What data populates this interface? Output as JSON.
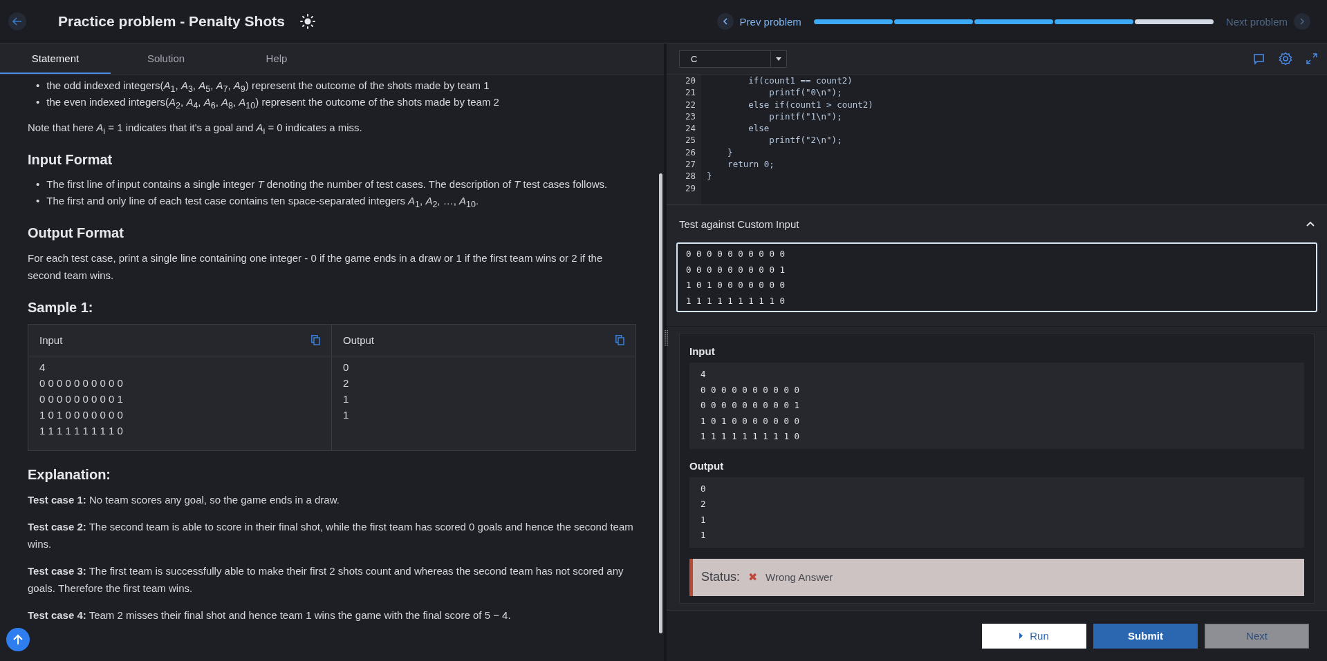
{
  "header": {
    "title": "Practice problem - Penalty Shots",
    "prev_label": "Prev problem",
    "next_label": "Next problem",
    "progress": [
      {
        "done": true
      },
      {
        "done": true
      },
      {
        "done": true
      },
      {
        "done": true
      },
      {
        "done": false
      }
    ]
  },
  "tabs": [
    {
      "label": "Statement",
      "selected": true
    },
    {
      "label": "Solution",
      "selected": false
    },
    {
      "label": "Help",
      "selected": false
    }
  ],
  "statement": [
    {
      "kind": "bullets",
      "items": [
        {
          "marker": "•",
          "text": "the odd indexed integers(*A*$_{1}$, *A*$_{3}$, *A*$_{5}$, *A*$_{7}$, *A*$_{9}$) represent the outcome of the shots made by team 1"
        },
        {
          "marker": "•",
          "text": "the even indexed integers(*A*$_{2}$, *A*$_{4}$, *A*$_{6}$, *A*$_{8}$, *A*$_{10}$) represent the outcome of the shots made by team 2"
        }
      ]
    },
    {
      "kind": "paragraph",
      "text": "Note that here *A*$_{i}$ = 1 indicates that it's a goal and *A*$_{i}$ = 0 indicates a miss."
    },
    {
      "kind": "heading",
      "text": "Input Format"
    },
    {
      "kind": "bullets",
      "items": [
        {
          "marker": "•",
          "text": "The first line of input contains a single integer *T* denoting the number of test cases. The description of *T* test cases follows."
        },
        {
          "marker": "•",
          "text": "The first and only line of each test case contains ten space-separated integers *A*$_{1}$, *A*$_{2}$, …, *A*$_{10}$."
        }
      ]
    },
    {
      "kind": "heading",
      "text": "Output Format"
    },
    {
      "kind": "paragraph",
      "text": "For each test case, print a single line containing one integer - 0 if the game ends in a draw or 1 if the first team wins or 2 if the second team wins."
    },
    {
      "kind": "heading",
      "text": "Sample 1:"
    },
    {
      "kind": "sample",
      "input_label": "Input",
      "output_label": "Output",
      "input_lines": [
        "4",
        "0 0 0 0 0 0 0 0 0 0",
        "0 0 0 0 0 0 0 0 0 1",
        "1 0 1 0 0 0 0 0 0 0",
        "1 1 1 1 1 1 1 1 1 0"
      ],
      "output_lines": [
        "0",
        "2",
        "1",
        "1"
      ]
    },
    {
      "kind": "heading",
      "text": "Explanation:"
    },
    {
      "kind": "paragraph",
      "text": "**Test case 1:** No team scores any goal, so the game ends in a draw."
    },
    {
      "kind": "paragraph",
      "text": "**Test case 2:** The second team is able to score in their final shot, while the first team has scored 0 goals and hence the second team wins."
    },
    {
      "kind": "paragraph",
      "text": "**Test case 3:** The first team is successfully able to make their first 2 shots count and whereas the second team has not scored any goals. Therefore the first team wins."
    },
    {
      "kind": "paragraph",
      "text": "**Test case 4:** Team 2 misses their final shot and hence team 1 wins the game with the final score of 5 − 4."
    }
  ],
  "editor": {
    "language": "C",
    "lines": [
      {
        "num": "20",
        "text": "        if(count1 == count2)"
      },
      {
        "num": "21",
        "text": "            printf(\"0\\n\");"
      },
      {
        "num": "22",
        "text": "        else if(count1 > count2)"
      },
      {
        "num": "23",
        "text": "            printf(\"1\\n\");"
      },
      {
        "num": "24",
        "text": "        else"
      },
      {
        "num": "25",
        "text": "            printf(\"2\\n\");"
      },
      {
        "num": "26",
        "text": "    }"
      },
      {
        "num": "27",
        "text": "    return 0;"
      },
      {
        "num": "28",
        "text": "}"
      },
      {
        "num": "29"
      }
    ]
  },
  "custom_input": {
    "title": "Test against Custom Input",
    "expanded": true,
    "lines": [
      "0 0 0 0 0 0 0 0 0 0",
      "0 0 0 0 0 0 0 0 0 1",
      "1 0 1 0 0 0 0 0 0 0",
      "1 1 1 1 1 1 1 1 1 0"
    ]
  },
  "result": {
    "input_label": "Input",
    "input_lines": [
      "4",
      "0 0 0 0 0 0 0 0 0 0",
      "0 0 0 0 0 0 0 0 0 1",
      "1 0 1 0 0 0 0 0 0 0",
      "1 1 1 1 1 1 1 1 1 0"
    ],
    "output_label": "Output",
    "output_lines": [
      "0",
      "2",
      "1",
      "1"
    ],
    "status_label": "Status:",
    "status_icon": "✖",
    "status_text": "Wrong Answer"
  },
  "buttons": [
    {
      "kind": "run",
      "label": "Run",
      "disabled": false
    },
    {
      "kind": "submit",
      "label": "Submit",
      "disabled": false
    },
    {
      "kind": "next",
      "label": "Next",
      "disabled": true
    }
  ]
}
